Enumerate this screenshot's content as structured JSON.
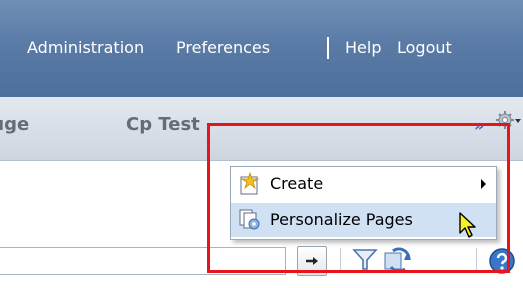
{
  "header": {
    "links": [
      "Administration",
      "Preferences",
      "Help",
      "Logout"
    ]
  },
  "tabs": {
    "partial_tab": "ıge",
    "current_tab": "Cp Test",
    "overflow": "»"
  },
  "menu": {
    "items": [
      {
        "label": "Create",
        "icon": "create-star-icon",
        "has_submenu": true
      },
      {
        "label": "Personalize Pages",
        "icon": "personalize-pages-icon",
        "has_submenu": false,
        "highlighted": true
      }
    ]
  },
  "colors": {
    "header_blue": "#5a7ba6",
    "highlight_box": "#e8141b",
    "menu_hover": "#cfe1f3"
  }
}
